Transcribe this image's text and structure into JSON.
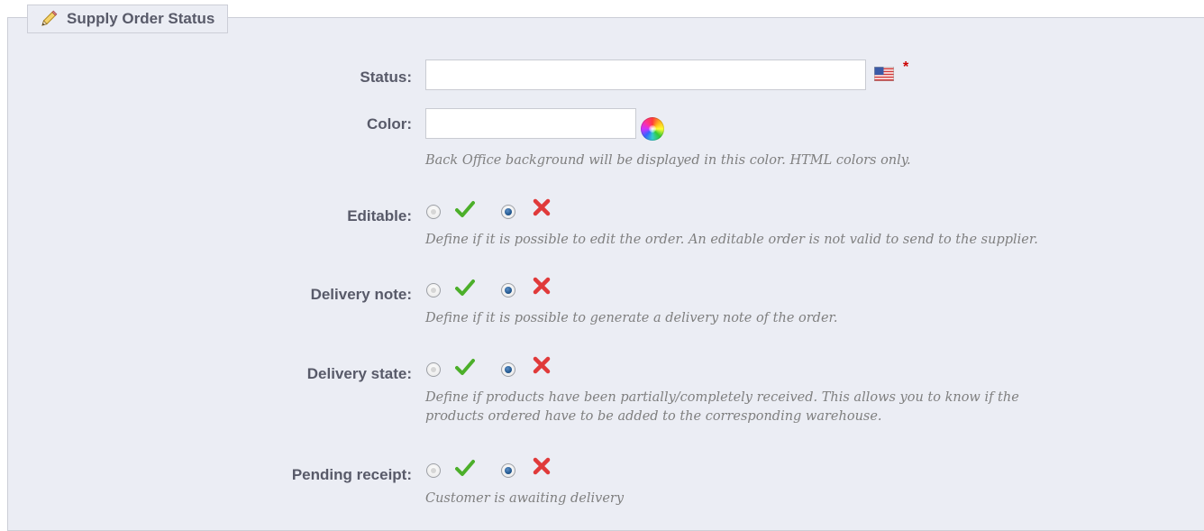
{
  "fieldset": {
    "title": "Supply Order Status",
    "title_icon": "pencil-icon"
  },
  "fields": {
    "status": {
      "label": "Status:",
      "value": "",
      "flag_icon": "us-flag-icon",
      "required_mark": "*"
    },
    "color": {
      "label": "Color:",
      "value": "",
      "picker_icon": "color-wheel-icon",
      "hint": "Back Office background will be displayed in this color. HTML colors only."
    },
    "editable": {
      "label": "Editable:",
      "selected": "no",
      "hint": "Define if it is possible to edit the order. An editable order is not valid to send to the supplier."
    },
    "delivery_note": {
      "label": "Delivery note:",
      "selected": "no",
      "hint": "Define if it is possible to generate a delivery note of the order."
    },
    "delivery_state": {
      "label": "Delivery state:",
      "selected": "no",
      "hint_line1": "Define if products have been partially/completely received. This allows you to know if the",
      "hint_line2": "products ordered have to be added to the corresponding warehouse."
    },
    "pending_receipt": {
      "label": "Pending receipt:",
      "selected": "no",
      "hint": "Customer is awaiting delivery"
    }
  },
  "colors": {
    "panel_bg": "#ebedf4",
    "label_text": "#585a69",
    "hint_text": "#7f7f7f",
    "yes_check": "#4caf2a",
    "no_cross": "#e03a3a",
    "required": "#cc0000"
  }
}
